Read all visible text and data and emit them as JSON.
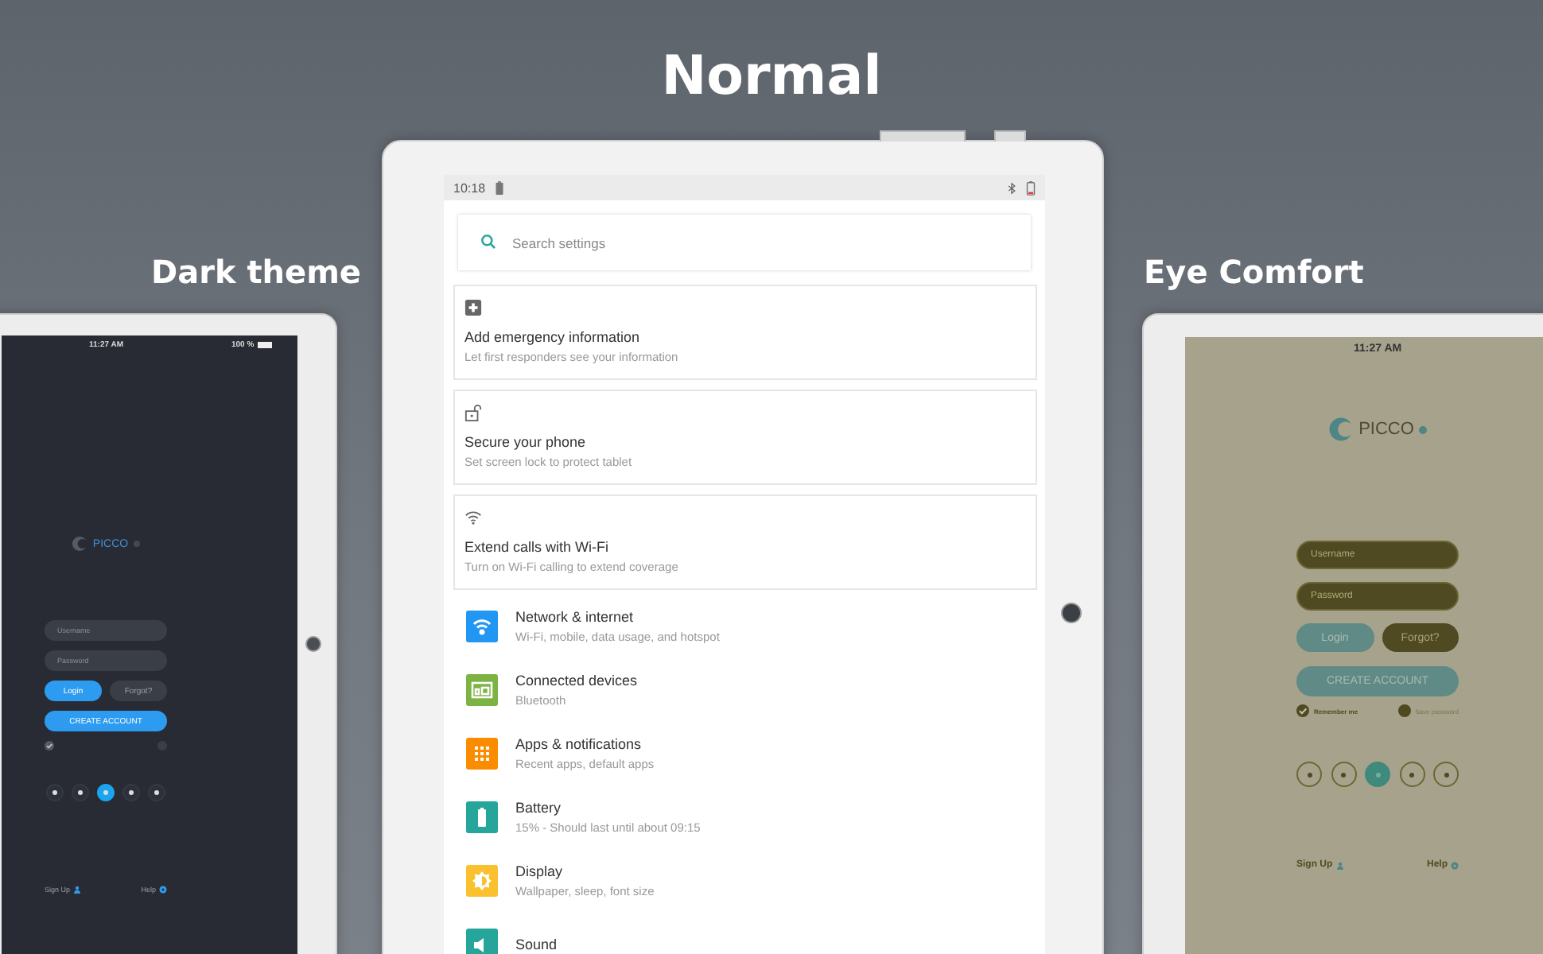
{
  "normal": {
    "heading": "Normal",
    "status_time": "10:18",
    "search": {
      "placeholder": "Search settings"
    },
    "suggestions": [
      {
        "kind": "emergency",
        "title": "Add emergency information",
        "subtitle": "Let first responders see your information"
      },
      {
        "kind": "lock",
        "title": "Secure your phone",
        "subtitle": "Set screen lock to protect tablet"
      },
      {
        "kind": "wifi",
        "title": "Extend calls with Wi-Fi",
        "subtitle": "Turn on Wi-Fi calling to extend coverage"
      }
    ],
    "items": [
      {
        "kind": "wifi",
        "color": "#2196f3",
        "title": "Network & internet",
        "subtitle": "Wi-Fi, mobile, data usage, and hotspot"
      },
      {
        "kind": "devices",
        "color": "#7cb342",
        "title": "Connected devices",
        "subtitle": "Bluetooth"
      },
      {
        "kind": "apps",
        "color": "#fb8c00",
        "title": "Apps & notifications",
        "subtitle": "Recent apps, default apps"
      },
      {
        "kind": "battery",
        "color": "#26a69a",
        "title": "Battery",
        "subtitle": "15% - Should last until about 09:15"
      },
      {
        "kind": "display",
        "color": "#fbc02d",
        "title": "Display",
        "subtitle": "Wallpaper, sleep, font size"
      },
      {
        "kind": "sound",
        "color": "#26a69a",
        "title": "Sound"
      }
    ]
  },
  "themes": [
    {
      "kind": "dark",
      "heading": "Dark theme",
      "time": "11:27 AM",
      "battery_text": "100 %",
      "brand": "PICCO",
      "username": {
        "placeholder": "Username"
      },
      "password": {
        "placeholder": "Password"
      },
      "login": "Login",
      "forgot": "Forgot?",
      "create": "CREATE ACCOUNT",
      "options": [
        {
          "checked": true
        },
        {
          "checked": false
        }
      ],
      "social": [
        {
          "selected": false
        },
        {
          "selected": false
        },
        {
          "selected": true
        },
        {
          "selected": false
        },
        {
          "selected": false
        }
      ],
      "sign_up": "Sign Up",
      "help": "Help"
    },
    {
      "kind": "eye-comfort",
      "heading": "Eye Comfort",
      "time": "11:27 AM",
      "brand": "PICCO",
      "username": {
        "placeholder": "Username"
      },
      "password": {
        "placeholder": "Password"
      },
      "login": "Login",
      "forgot": "Forgot?",
      "create": "CREATE ACCOUNT",
      "options": [
        {
          "label": "Remember me",
          "checked": true
        },
        {
          "label": "Save password",
          "checked": false
        }
      ],
      "social": [
        {
          "selected": false
        },
        {
          "selected": false
        },
        {
          "selected": true
        },
        {
          "selected": false
        },
        {
          "selected": false
        }
      ],
      "sign_up": "Sign Up",
      "help": "Help"
    }
  ]
}
